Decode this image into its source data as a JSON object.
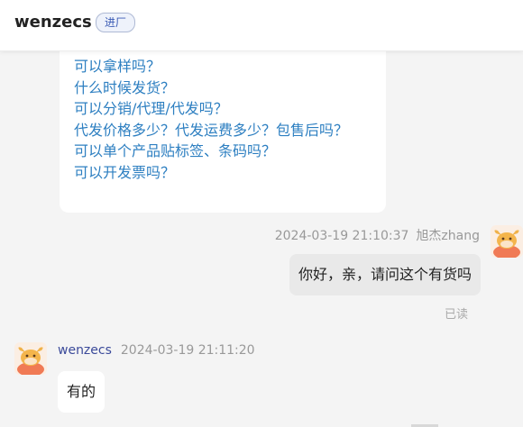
{
  "header": {
    "shop_name": "wenzecs",
    "badge": "进厂"
  },
  "faq": {
    "items": [
      "可以拿样吗？",
      "什么时候发货？",
      "可以分销/代理/代发吗？",
      "代发价格多少？代发运费多少？包售后吗？",
      "可以单个产品贴标签、条码吗？",
      "可以开发票吗？"
    ]
  },
  "messages": [
    {
      "side": "right",
      "timestamp": "2024-03-19 21:10:37",
      "sender": "旭杰zhang",
      "text": "你好，亲，请问这个有货吗",
      "status": "已读",
      "avatar": "mascot-avatar-icon"
    },
    {
      "side": "left",
      "timestamp": "2024-03-19 21:11:20",
      "sender": "wenzecs",
      "text": "有的",
      "avatar": "mascot-avatar-icon"
    }
  ],
  "colors": {
    "link": "#2d7fc1",
    "seller_name": "#3b4a9a",
    "badge_text": "#3b5bb5"
  }
}
